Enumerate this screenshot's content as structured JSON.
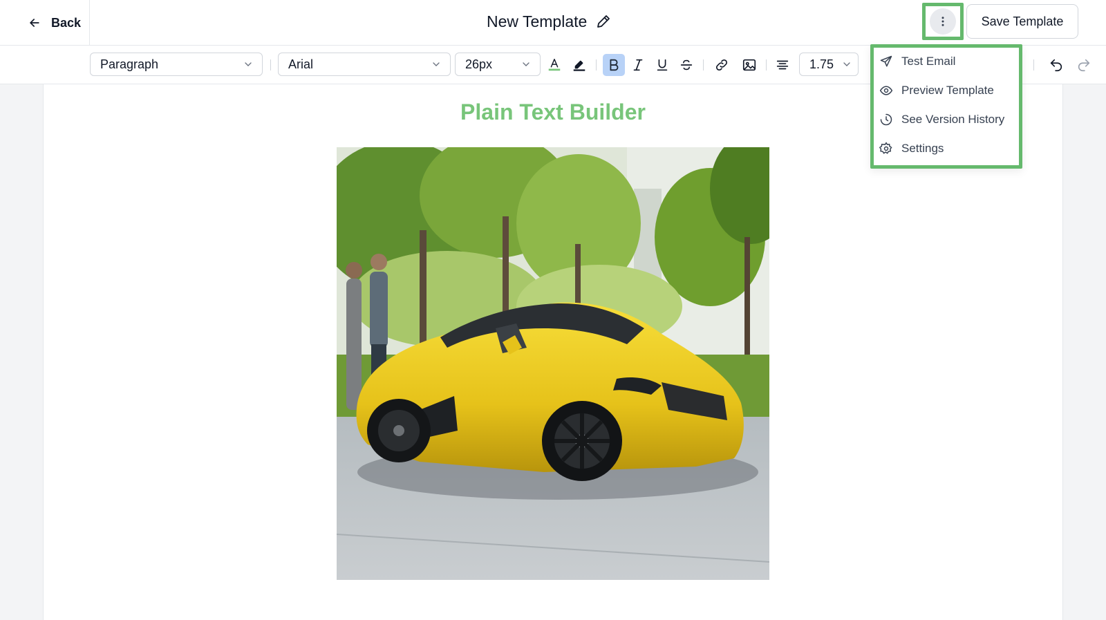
{
  "header": {
    "back_label": "Back",
    "title": "New Template",
    "save_label": "Save Template"
  },
  "toolbar": {
    "block_type": "Paragraph",
    "font_family": "Arial",
    "font_size": "26px",
    "line_height": "1.75",
    "text_color": "#78c57a",
    "highlight_color": "#111827"
  },
  "menu": {
    "items": [
      {
        "label": "Test Email",
        "icon": "send-icon"
      },
      {
        "label": "Preview Template",
        "icon": "eye-icon"
      },
      {
        "label": "See Version History",
        "icon": "history-icon"
      },
      {
        "label": "Settings",
        "icon": "gear-icon"
      }
    ]
  },
  "content": {
    "heading": "Plain Text Builder",
    "heading_color": "#78c57a"
  },
  "colors": {
    "highlight_box": "#65b96d",
    "active_format": "#b8d2f7"
  }
}
